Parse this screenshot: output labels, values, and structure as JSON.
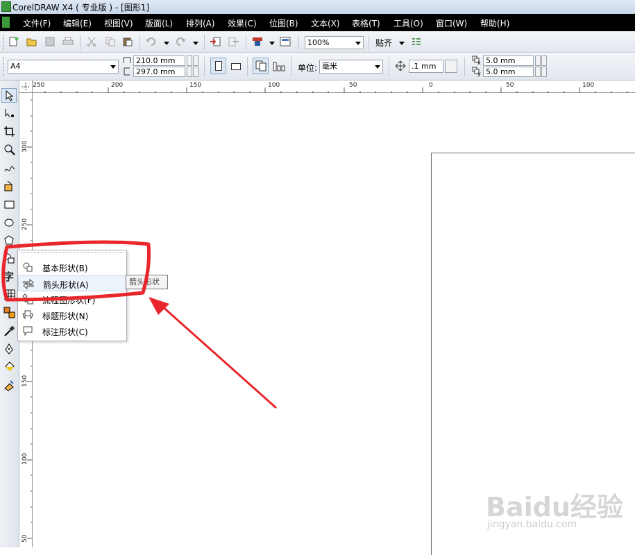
{
  "title": "CorelDRAW X4 ( 专业版 ) - [图形1]",
  "menus": [
    "文件(F)",
    "编辑(E)",
    "视图(V)",
    "版面(L)",
    "排列(A)",
    "效果(C)",
    "位图(B)",
    "文本(X)",
    "表格(T)",
    "工具(O)",
    "窗口(W)",
    "帮助(H)"
  ],
  "toolbar": {
    "zoom": "100%",
    "snap_label": "贴齐"
  },
  "property_bar": {
    "paper_size": "A4",
    "width": "210.0 mm",
    "height": "297.0 mm",
    "units_label": "单位:",
    "units_value": "毫米",
    "nudge": ".1 mm",
    "dup_x": "5.0 mm",
    "dup_y": "5.0 mm",
    "dup_x_sub": "x",
    "dup_y_sub": "y"
  },
  "ruler_top": [
    "250",
    "200",
    "150",
    "100",
    "50",
    "0",
    "50",
    "100"
  ],
  "ruler_left": [
    "300",
    "250",
    "200",
    "150",
    "100",
    "50"
  ],
  "toolbox_text_tool": "字",
  "flyout": {
    "items": [
      {
        "label": "基本形状(B)",
        "icon": "basic-shapes-icon"
      },
      {
        "label": "箭头形状(A)",
        "icon": "arrow-shapes-icon"
      },
      {
        "label": "流程图形状(F)",
        "icon": "flowchart-shapes-icon"
      },
      {
        "label": "标题形状(N)",
        "icon": "banner-shapes-icon"
      },
      {
        "label": "标注形状(C)",
        "icon": "callout-shapes-icon"
      }
    ]
  },
  "tooltip": "箭头形状",
  "watermark": {
    "text": "Baidu经验",
    "sub": "jingyan.baidu.com"
  },
  "annotation_color": "#e8262b"
}
